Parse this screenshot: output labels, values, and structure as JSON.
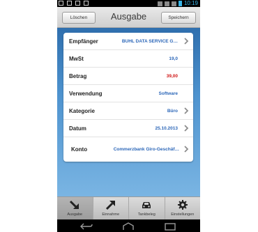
{
  "status_bar": {
    "time": "10:19"
  },
  "header": {
    "title": "Ausgabe",
    "left_button": "Löschen",
    "right_button": "Speichern"
  },
  "form": {
    "rows": [
      {
        "label": "Empfänger",
        "value": "BUHL DATA SERVICE G…",
        "chevron": true
      },
      {
        "label": "MwSt",
        "value": "19,0",
        "chevron": false
      },
      {
        "label": "Betrag",
        "value": "39,00",
        "chevron": false
      },
      {
        "label": "Verwendung",
        "value": "Software",
        "chevron": false
      },
      {
        "label": "Kategorie",
        "value": "Büro",
        "chevron": true
      },
      {
        "label": "Datum",
        "value": "25.10.2013",
        "chevron": true
      },
      {
        "label": "Konto",
        "value": "Commerzbank Giro-Geschäf…",
        "chevron": true
      }
    ]
  },
  "tabs": [
    {
      "label": "Ausgabe",
      "icon": "arrow-down-right-icon",
      "active": true
    },
    {
      "label": "Einnahme",
      "icon": "arrow-up-right-icon",
      "active": false
    },
    {
      "label": "Tankbeleg",
      "icon": "car-icon",
      "active": false
    },
    {
      "label": "Einstellungen",
      "icon": "gear-icon",
      "active": false
    }
  ],
  "colors": {
    "accent_blue": "#2b66b8",
    "amount_red": "#d01616",
    "background_top": "#2f6fae",
    "background_bottom": "#7ab5e3"
  }
}
